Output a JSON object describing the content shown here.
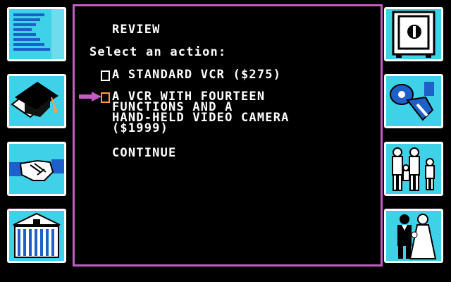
{
  "screen": {
    "heading": "REVIEW",
    "prompt": "Select an action:",
    "options": [
      {
        "lines": [
          "A STANDARD VCR ($275)"
        ]
      },
      {
        "lines": [
          "A VCR WITH FOURTEEN",
          "FUNCTIONS AND A",
          "HAND-HELD VIDEO CAMERA",
          "($1999)"
        ]
      }
    ],
    "continue_label": "CONTINUE"
  },
  "side_icons": {
    "left": [
      "document-lines-icon",
      "graduation-cap-icon",
      "handshake-icon",
      "bank-icon"
    ],
    "right": [
      "safe-icon",
      "map-pin-icon",
      "family-icon",
      "wedding-couple-icon"
    ]
  },
  "colors": {
    "background": "#000000",
    "panel_border": "#c45cc4",
    "tile_background": "#3fd1e8",
    "tile_border": "#ffffff",
    "text": "#ffffff",
    "checkbox_highlight": "#ff9f40",
    "pointer": "#c45cc4"
  }
}
